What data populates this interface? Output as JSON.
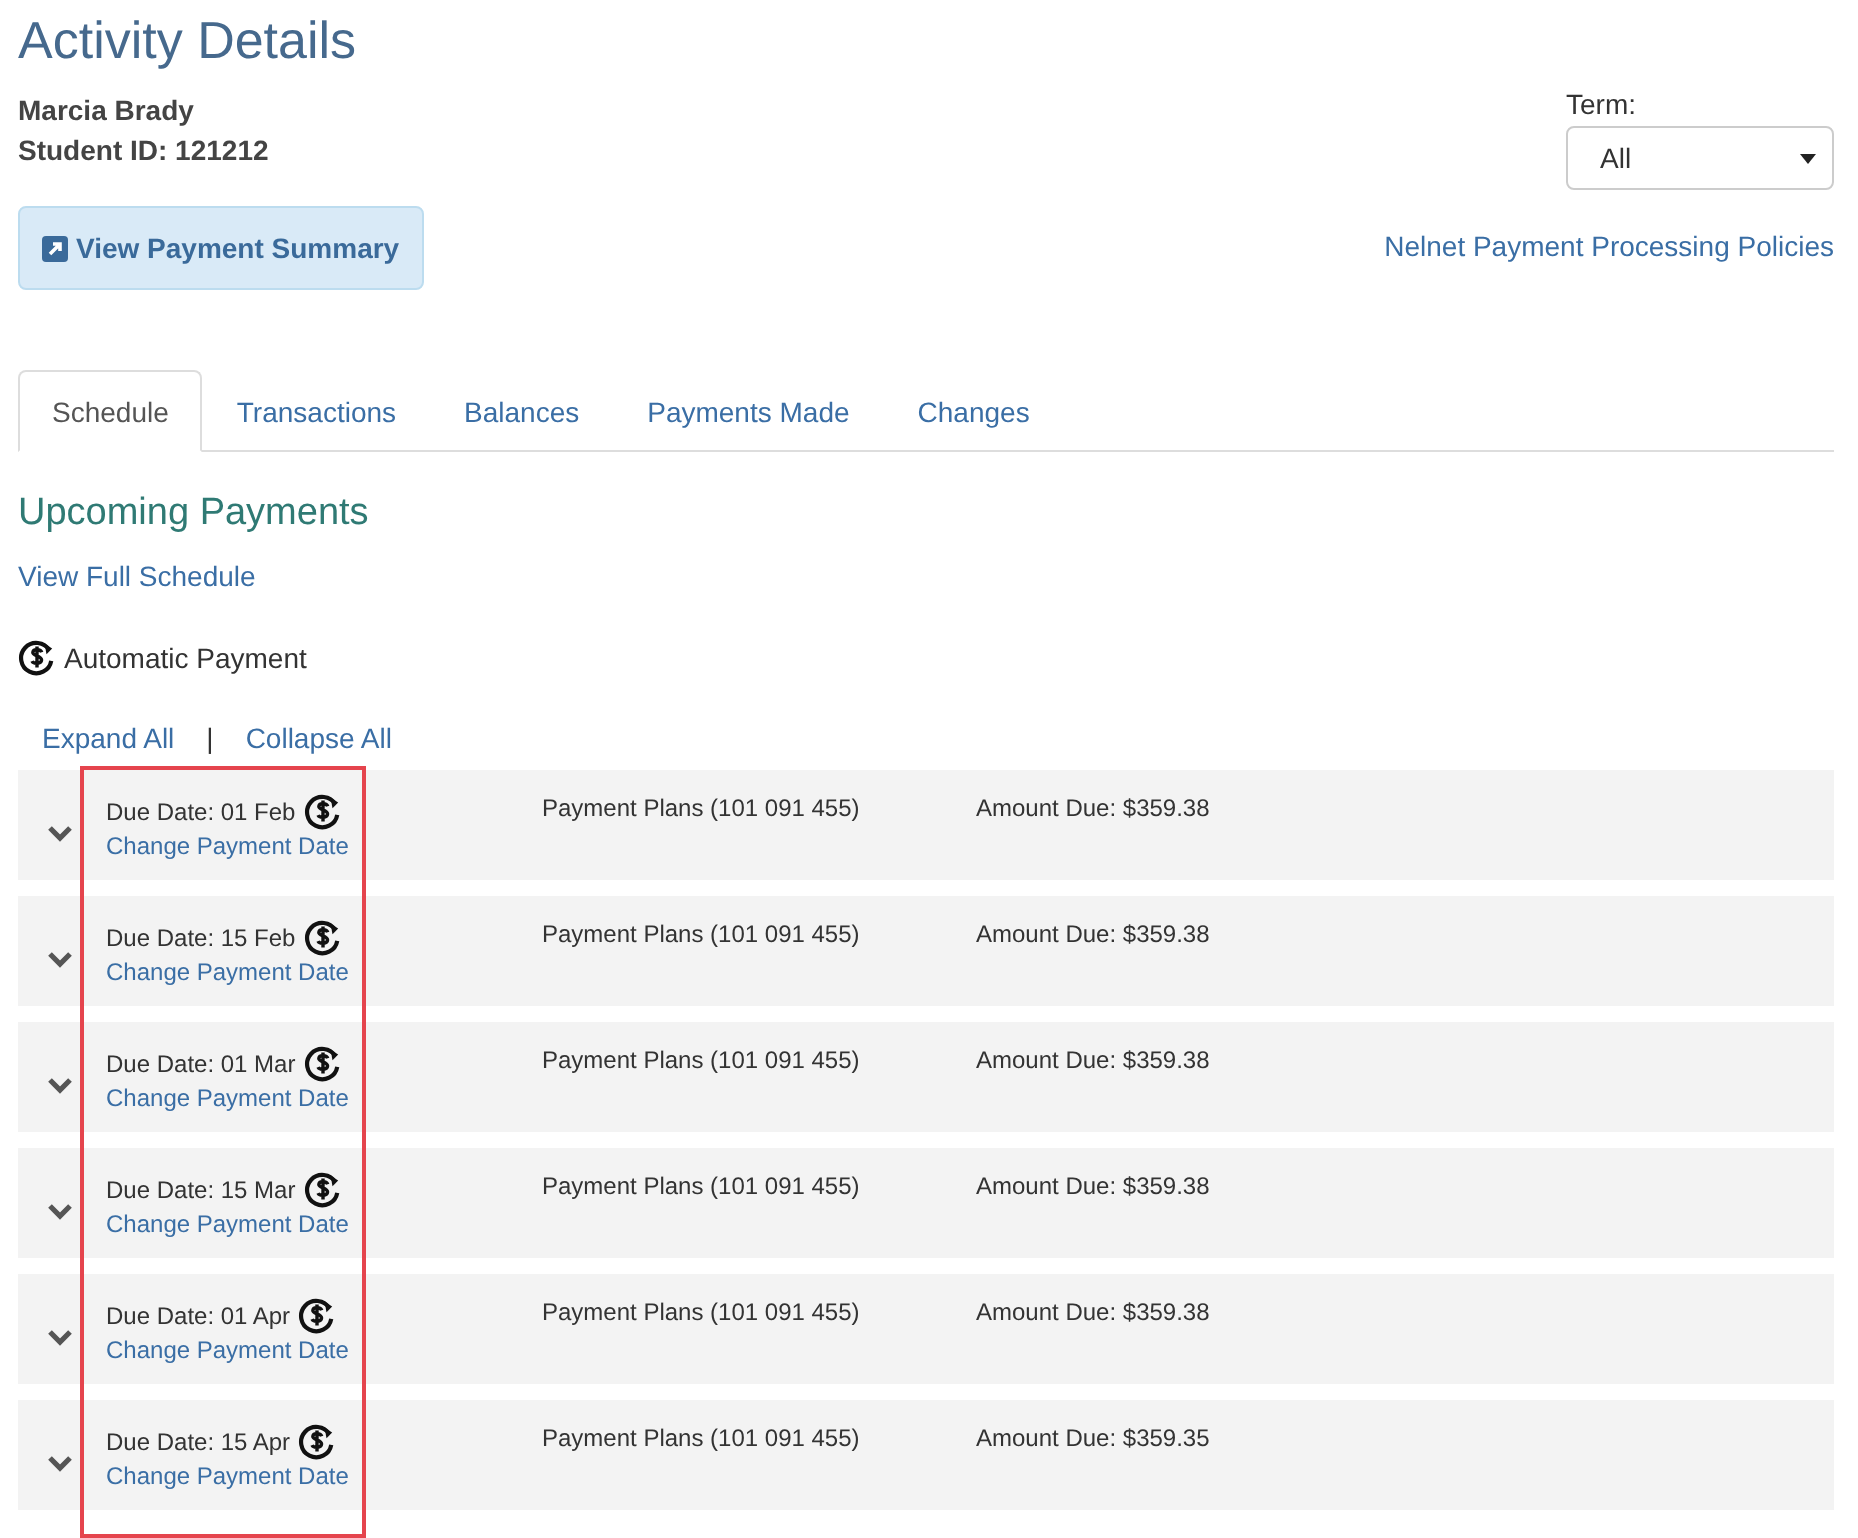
{
  "title": "Activity Details",
  "student": {
    "name": "Marcia Brady",
    "id_line": "Student ID: 121212"
  },
  "summary_button": "View Payment Summary",
  "term": {
    "label": "Term:",
    "value": "All"
  },
  "policies_link": "Nelnet Payment Processing Policies",
  "tabs": [
    {
      "label": "Schedule",
      "selected": true
    },
    {
      "label": "Transactions",
      "selected": false
    },
    {
      "label": "Balances",
      "selected": false
    },
    {
      "label": "Payments Made",
      "selected": false
    },
    {
      "label": "Changes",
      "selected": false
    }
  ],
  "section_title": "Upcoming Payments",
  "full_schedule_link": "View Full Schedule",
  "legend": "Automatic Payment",
  "expand_all": "Expand All",
  "separator": "|",
  "collapse_all": "Collapse All",
  "highlight_due_column": true,
  "payments": [
    {
      "due": "Due Date: 01 Feb",
      "automatic": true,
      "change_link": "Change Payment Date",
      "plan": "Payment Plans (101 091 455)",
      "amount_label": "Amount Due:",
      "amount": "$359.38",
      "expanded": false
    },
    {
      "due": "Due Date: 15 Feb",
      "automatic": true,
      "change_link": "Change Payment Date",
      "plan": "Payment Plans (101 091 455)",
      "amount_label": "Amount Due:",
      "amount": "$359.38",
      "expanded": false
    },
    {
      "due": "Due Date: 01 Mar",
      "automatic": true,
      "change_link": "Change Payment Date",
      "plan": "Payment Plans (101 091 455)",
      "amount_label": "Amount Due:",
      "amount": "$359.38",
      "expanded": false
    },
    {
      "due": "Due Date: 15 Mar",
      "automatic": true,
      "change_link": "Change Payment Date",
      "plan": "Payment Plans (101 091 455)",
      "amount_label": "Amount Due:",
      "amount": "$359.38",
      "expanded": false
    },
    {
      "due": "Due Date: 01 Apr",
      "automatic": true,
      "change_link": "Change Payment Date",
      "plan": "Payment Plans (101 091 455)",
      "amount_label": "Amount Due:",
      "amount": "$359.38",
      "expanded": false
    },
    {
      "due": "Due Date: 15 Apr",
      "automatic": true,
      "change_link": "Change Payment Date",
      "plan": "Payment Plans (101 091 455)",
      "amount_label": "Amount Due:",
      "amount": "$359.35",
      "expanded": false
    }
  ]
}
